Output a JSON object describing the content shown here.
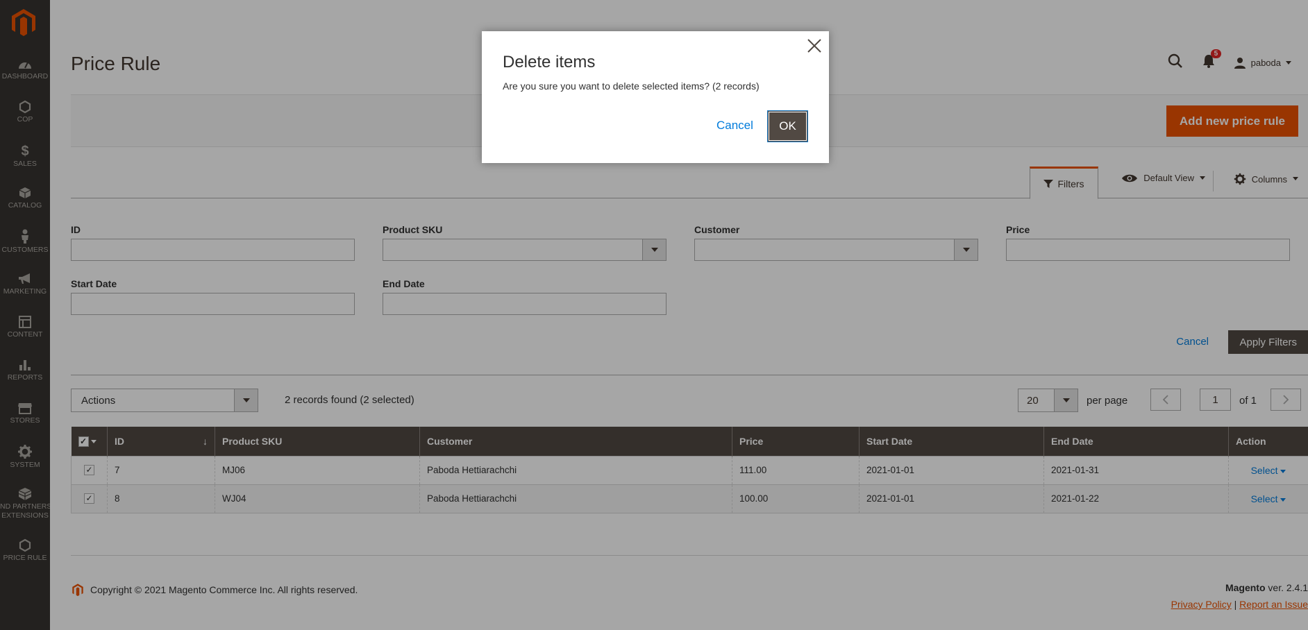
{
  "sidebar": {
    "items": [
      {
        "label": "DASHBOARD",
        "icon": "dashboard-icon"
      },
      {
        "label": "COP",
        "icon": "hexagon-icon"
      },
      {
        "label": "SALES",
        "icon": "dollar-icon"
      },
      {
        "label": "CATALOG",
        "icon": "box-icon"
      },
      {
        "label": "CUSTOMERS",
        "icon": "person-icon"
      },
      {
        "label": "MARKETING",
        "icon": "megaphone-icon"
      },
      {
        "label": "CONTENT",
        "icon": "layout-icon"
      },
      {
        "label": "REPORTS",
        "icon": "bar-chart-icon"
      },
      {
        "label": "STORES",
        "icon": "store-icon"
      },
      {
        "label": "SYSTEM",
        "icon": "gear-icon"
      },
      {
        "label": "ND PARTNERS",
        "label2": "EXTENSIONS",
        "icon": "cube-icon"
      },
      {
        "label": "PRICE RULE",
        "icon": "hexagon-icon"
      }
    ]
  },
  "header": {
    "title": "Price Rule",
    "notification_count": "5",
    "username": "paboda"
  },
  "page_actions": {
    "add_button": "Add new price rule"
  },
  "grid_controls": {
    "filters_label": "Filters",
    "view_label": "Default View",
    "columns_label": "Columns"
  },
  "filters": {
    "id_label": "ID",
    "sku_label": "Product SKU",
    "customer_label": "Customer",
    "price_label": "Price",
    "start_label": "Start Date",
    "end_label": "End Date",
    "cancel_label": "Cancel",
    "apply_label": "Apply Filters"
  },
  "toolbar": {
    "actions_label": "Actions",
    "records_text": "2 records found (2 selected)",
    "per_page_value": "20",
    "per_page_label": "per page",
    "page_value": "1",
    "page_of": "of 1"
  },
  "table": {
    "headers": [
      "ID",
      "Product SKU",
      "Customer",
      "Price",
      "Start Date",
      "End Date",
      "Action"
    ],
    "sort_indicator": "↓",
    "rows": [
      {
        "id": "7",
        "sku": "MJ06",
        "customer": "Paboda Hettiarachchi",
        "price": "111.00",
        "start": "2021-01-01",
        "end": "2021-01-31",
        "action": "Select"
      },
      {
        "id": "8",
        "sku": "WJ04",
        "customer": "Paboda Hettiarachchi",
        "price": "100.00",
        "start": "2021-01-01",
        "end": "2021-01-22",
        "action": "Select"
      }
    ]
  },
  "footer": {
    "copyright": "Copyright © 2021 Magento Commerce Inc. All rights reserved.",
    "brand": "Magento",
    "version": " ver. 2.4.1",
    "privacy": "Privacy Policy",
    "separator": "|",
    "report": "Report an Issue"
  },
  "modal": {
    "title": "Delete items",
    "message": "Are you sure you want to delete selected items? (2 records)",
    "cancel_label": "Cancel",
    "ok_label": "OK"
  },
  "colors": {
    "brand_orange": "#eb5202",
    "sidebar_bg": "#373330",
    "header_dark": "#514943",
    "link_blue": "#007bdb"
  }
}
